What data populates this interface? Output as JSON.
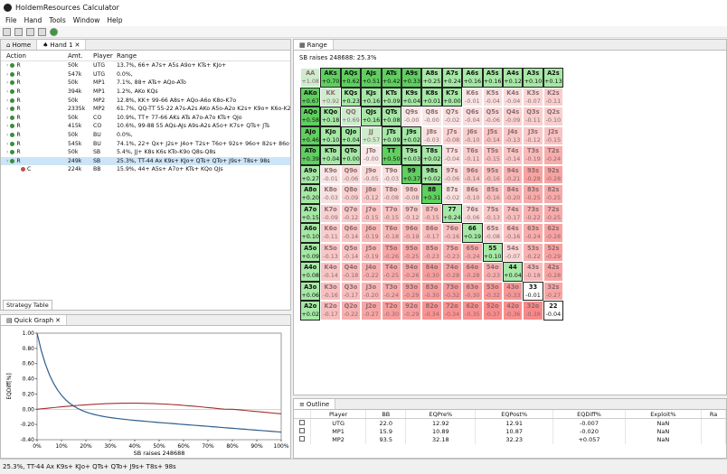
{
  "app": {
    "title": "HoldemResources Calculator"
  },
  "menu": [
    "File",
    "Hand",
    "Tools",
    "Window",
    "Help"
  ],
  "left_tabs": [
    "Home",
    "Hand 1"
  ],
  "action_table": {
    "headers": [
      "Action",
      "Amt.",
      "Player",
      "Range"
    ],
    "rows": [
      [
        "R",
        "50k",
        "UTG",
        "13.7%, 66+ A7s+ A5s A9o+ KTs+ KJo+"
      ],
      [
        "R",
        "547k",
        "UTG",
        "0.0%,"
      ],
      [
        "R",
        "50k",
        "MP1",
        "7.1%, 88+ ATs+ AQo-ATo"
      ],
      [
        "R",
        "394k",
        "MP1",
        "1.2%, AKo KQs"
      ],
      [
        "R",
        "50k",
        "MP2",
        "12.8%, KK+ 99-66 A8s+ AQo-A6o K8o-K7o"
      ],
      [
        "R",
        "2335k",
        "MP2",
        "61.7%, QQ-TT 55-22 A7s-A2s AKo A5o-A2o K2s+ K9o+ K6o-K2o"
      ],
      [
        "R",
        "50k",
        "CO",
        "10.9%, TT+ 77-66 AKs ATs A7o-A7o KTs+ QJo"
      ],
      [
        "R",
        "415k",
        "CO",
        "10.6%, 99-88 55 AQs-AJs A9s-A2s A5o+ K7s+ QTs+ JTs"
      ],
      [
        "R",
        "50k",
        "BU",
        "0.0%,"
      ],
      [
        "R",
        "545k",
        "BU",
        "74.1%, 22+ Qx+ J2s+ J4o+ T2s+ T6o+ 92s+ 96o+ 82s+ 86o+ 73s"
      ],
      [
        "R",
        "50k",
        "SB",
        "5.4%, JJ+ K8s K6s KTo-K9o Q8s-Q8s"
      ],
      [
        "R",
        "249k",
        "SB",
        "25.3%, TT-44 Ax K9s+ KJo+ QTs+ QTo+ J9s+ T8s+ 98s"
      ],
      [
        "C",
        "224k",
        "BB",
        "15.9%, 44+ A5s+ A7o+ KTs+ KQo QJs"
      ]
    ]
  },
  "strategy_tab": "Strategy Table",
  "graph": {
    "tab": "Quick Graph",
    "ylabel": "EQDiff[%]",
    "xlabel": "SB raises 248688",
    "yticks": [
      "1.00",
      "0.80",
      "0.60",
      "0.40",
      "0.20",
      "0.00",
      "-0.20",
      "-0.40"
    ],
    "xticks": [
      "0%",
      "10%",
      "20%",
      "30%",
      "40%",
      "50%",
      "60%",
      "70%",
      "80%",
      "90%",
      "100%"
    ]
  },
  "range": {
    "tab": "Range",
    "subtitle": "SB raises 248688: 25.3%",
    "cells": [
      [
        [
          "AA",
          "+1.08",
          0
        ],
        [
          "AKs",
          "+0.70",
          1
        ],
        [
          "AQs",
          "+0.62",
          1
        ],
        [
          "AJs",
          "+0.51",
          1
        ],
        [
          "ATs",
          "+0.42",
          1
        ],
        [
          "A9s",
          "+0.33",
          1
        ],
        [
          "A8s",
          "+0.25",
          1
        ],
        [
          "A7s",
          "+0.24",
          1
        ],
        [
          "A6s",
          "+0.16",
          1
        ],
        [
          "A5s",
          "+0.16",
          1
        ],
        [
          "A4s",
          "+0.12",
          1
        ],
        [
          "A3s",
          "+0.10",
          1
        ],
        [
          "A2s",
          "+0.13",
          1
        ]
      ],
      [
        [
          "AKo",
          "+0.67",
          1
        ],
        [
          "KK",
          "+0.92",
          0
        ],
        [
          "KQs",
          "+0.23",
          1
        ],
        [
          "KJs",
          "+0.16",
          1
        ],
        [
          "KTs",
          "+0.09",
          1
        ],
        [
          "K9s",
          "+0.04",
          1
        ],
        [
          "K8s",
          "+0.01",
          1
        ],
        [
          "K7s",
          "+0.00",
          1
        ],
        [
          "K6s",
          "-0.01",
          0
        ],
        [
          "K5s",
          "-0.04",
          0
        ],
        [
          "K4s",
          "-0.04",
          0
        ],
        [
          "K3s",
          "-0.07",
          0
        ],
        [
          "K2s",
          "-0.11",
          0
        ]
      ],
      [
        [
          "AQo",
          "+0.58",
          1
        ],
        [
          "KQo",
          "+0.18",
          1
        ],
        [
          "QQ",
          "+0.69",
          0
        ],
        [
          "QJs",
          "+0.16",
          1
        ],
        [
          "QTs",
          "+0.08",
          1
        ],
        [
          "Q9s",
          "-0.00",
          0
        ],
        [
          "Q8s",
          "-0.00",
          0
        ],
        [
          "Q7s",
          "-0.02",
          0
        ],
        [
          "Q6s",
          "-0.04",
          0
        ],
        [
          "Q5s",
          "-0.06",
          0
        ],
        [
          "Q4s",
          "-0.09",
          0
        ],
        [
          "Q3s",
          "-0.11",
          0
        ],
        [
          "Q2s",
          "-0.10",
          0
        ]
      ],
      [
        [
          "AJo",
          "+0.46",
          1
        ],
        [
          "KJo",
          "+0.10",
          1
        ],
        [
          "QJo",
          "+0.04",
          1
        ],
        [
          "JJ",
          "+0.57",
          0
        ],
        [
          "JTs",
          "+0.09",
          1
        ],
        [
          "J9s",
          "+0.02",
          1
        ],
        [
          "J8s",
          "-0.03",
          0
        ],
        [
          "J7s",
          "-0.08",
          0
        ],
        [
          "J6s",
          "-0.10",
          0
        ],
        [
          "J5s",
          "-0.14",
          0
        ],
        [
          "J4s",
          "-0.13",
          0
        ],
        [
          "J3s",
          "-0.12",
          0
        ],
        [
          "J2s",
          "-0.15",
          0
        ]
      ],
      [
        [
          "ATo",
          "+0.39",
          1
        ],
        [
          "KTo",
          "+0.04",
          1
        ],
        [
          "QTo",
          "+0.00",
          1
        ],
        [
          "JTo",
          "-0.00",
          0
        ],
        [
          "TT",
          "+0.50",
          1
        ],
        [
          "T9s",
          "+0.03",
          1
        ],
        [
          "T8s",
          "+0.02",
          1
        ],
        [
          "T7s",
          "-0.04",
          0
        ],
        [
          "T6s",
          "-0.11",
          0
        ],
        [
          "T5s",
          "-0.15",
          0
        ],
        [
          "T4s",
          "-0.14",
          0
        ],
        [
          "T3s",
          "-0.19",
          0
        ],
        [
          "T2s",
          "-0.24",
          0
        ]
      ],
      [
        [
          "A9o",
          "+0.27",
          1
        ],
        [
          "K9o",
          "-0.01",
          0
        ],
        [
          "Q9o",
          "-0.06",
          0
        ],
        [
          "J9o",
          "-0.05",
          0
        ],
        [
          "T9o",
          "-0.03",
          0
        ],
        [
          "99",
          "+0.37",
          1
        ],
        [
          "98s",
          "+0.02",
          1
        ],
        [
          "97s",
          "-0.06",
          0
        ],
        [
          "96s",
          "-0.14",
          0
        ],
        [
          "95s",
          "-0.16",
          0
        ],
        [
          "94s",
          "-0.21",
          0
        ],
        [
          "93s",
          "-0.28",
          0
        ],
        [
          "92s",
          "-0.28",
          0
        ]
      ],
      [
        [
          "A8o",
          "+0.20",
          1
        ],
        [
          "K8o",
          "-0.03",
          0
        ],
        [
          "Q8o",
          "-0.09",
          0
        ],
        [
          "J8o",
          "-0.12",
          0
        ],
        [
          "T8o",
          "-0.08",
          0
        ],
        [
          "98o",
          "-0.08",
          0
        ],
        [
          "88",
          "+0.31",
          1
        ],
        [
          "87s",
          "-0.02",
          0
        ],
        [
          "86s",
          "-0.10",
          0
        ],
        [
          "85s",
          "-0.16",
          0
        ],
        [
          "84s",
          "-0.20",
          0
        ],
        [
          "83s",
          "-0.25",
          0
        ],
        [
          "82s",
          "-0.25",
          0
        ]
      ],
      [
        [
          "A7o",
          "+0.15",
          1
        ],
        [
          "K7o",
          "-0.09",
          0
        ],
        [
          "Q7o",
          "-0.12",
          0
        ],
        [
          "J7o",
          "-0.15",
          0
        ],
        [
          "T7o",
          "-0.15",
          0
        ],
        [
          "97o",
          "-0.12",
          0
        ],
        [
          "87o",
          "-0.15",
          0
        ],
        [
          "77",
          "+0.24",
          1
        ],
        [
          "76s",
          "-0.06",
          0
        ],
        [
          "75s",
          "-0.13",
          0
        ],
        [
          "74s",
          "-0.17",
          0
        ],
        [
          "73s",
          "-0.22",
          0
        ],
        [
          "72s",
          "-0.25",
          0
        ]
      ],
      [
        [
          "A6o",
          "+0.10",
          1
        ],
        [
          "K6o",
          "-0.11",
          0
        ],
        [
          "Q6o",
          "-0.14",
          0
        ],
        [
          "J6o",
          "-0.19",
          0
        ],
        [
          "T6o",
          "-0.18",
          0
        ],
        [
          "96o",
          "-0.19",
          0
        ],
        [
          "86o",
          "-0.17",
          0
        ],
        [
          "76o",
          "-0.16",
          0
        ],
        [
          "66",
          "+0.19",
          1
        ],
        [
          "65s",
          "-0.08",
          0
        ],
        [
          "64s",
          "-0.16",
          0
        ],
        [
          "63s",
          "-0.24",
          0
        ],
        [
          "62s",
          "-0.28",
          0
        ]
      ],
      [
        [
          "A5o",
          "+0.09",
          1
        ],
        [
          "K5o",
          "-0.13",
          0
        ],
        [
          "Q5o",
          "-0.14",
          0
        ],
        [
          "J5o",
          "-0.19",
          0
        ],
        [
          "T5o",
          "-0.26",
          0
        ],
        [
          "95o",
          "-0.25",
          0
        ],
        [
          "85o",
          "-0.23",
          0
        ],
        [
          "75o",
          "-0.23",
          0
        ],
        [
          "65o",
          "-0.24",
          0
        ],
        [
          "55",
          "+0.10",
          1
        ],
        [
          "54s",
          "-0.07",
          0
        ],
        [
          "53s",
          "-0.22",
          0
        ],
        [
          "52s",
          "-0.29",
          0
        ]
      ],
      [
        [
          "A4o",
          "+0.08",
          1
        ],
        [
          "K4o",
          "-0.14",
          0
        ],
        [
          "Q4o",
          "-0.18",
          0
        ],
        [
          "J4o",
          "-0.22",
          0
        ],
        [
          "T4o",
          "-0.25",
          0
        ],
        [
          "94o",
          "-0.26",
          0
        ],
        [
          "84o",
          "-0.30",
          0
        ],
        [
          "74o",
          "-0.28",
          0
        ],
        [
          "64o",
          "-0.28",
          0
        ],
        [
          "54o",
          "-0.23",
          0
        ],
        [
          "44",
          "+0.04",
          1
        ],
        [
          "43s",
          "-0.18",
          0
        ],
        [
          "42s",
          "-0.28",
          0
        ]
      ],
      [
        [
          "A3o",
          "+0.06",
          1
        ],
        [
          "K3o",
          "-0.16",
          0
        ],
        [
          "Q3o",
          "-0.17",
          0
        ],
        [
          "J3o",
          "-0.20",
          0
        ],
        [
          "T3o",
          "-0.24",
          0
        ],
        [
          "93o",
          "-0.29",
          0
        ],
        [
          "83o",
          "-0.30",
          0
        ],
        [
          "73o",
          "-0.32",
          0
        ],
        [
          "63o",
          "-0.30",
          0
        ],
        [
          "53o",
          "-0.32",
          0
        ],
        [
          "43o",
          "-0.33",
          0
        ],
        [
          "33",
          "-0.01",
          2
        ],
        [
          "32s",
          "-0.27",
          0
        ]
      ],
      [
        [
          "A2o",
          "+0.02",
          1
        ],
        [
          "K2o",
          "-0.17",
          0
        ],
        [
          "Q2o",
          "-0.22",
          0
        ],
        [
          "J2o",
          "-0.27",
          0
        ],
        [
          "T2o",
          "-0.30",
          0
        ],
        [
          "92o",
          "-0.29",
          0
        ],
        [
          "82o",
          "-0.34",
          0
        ],
        [
          "72o",
          "-0.34",
          0
        ],
        [
          "62o",
          "-0.35",
          0
        ],
        [
          "52o",
          "-0.37",
          0
        ],
        [
          "42o",
          "-0.36",
          0
        ],
        [
          "32o",
          "-0.38",
          0
        ],
        [
          "22",
          "-0.04",
          2
        ]
      ]
    ]
  },
  "outline": {
    "tab": "Outline",
    "headers": [
      "",
      "Player",
      "BB",
      "EQPre%",
      "EQPost%",
      "EQDiff%",
      "Exploit%",
      "Ra"
    ],
    "rows": [
      [
        "",
        "UTG",
        "22.0",
        "12.92",
        "12.91",
        "-0.007",
        "NaN",
        ""
      ],
      [
        "",
        "MP1",
        "15.9",
        "10.89",
        "10.87",
        "-0.020",
        "NaN",
        ""
      ],
      [
        "",
        "MP2",
        "93.5",
        "32.18",
        "32.23",
        "+0.057",
        "NaN",
        ""
      ]
    ]
  },
  "status": "25.3%, TT-44 Ax K9s+ KJo+ QTs+ QTo+ J9s+ T8s+ 98s"
}
